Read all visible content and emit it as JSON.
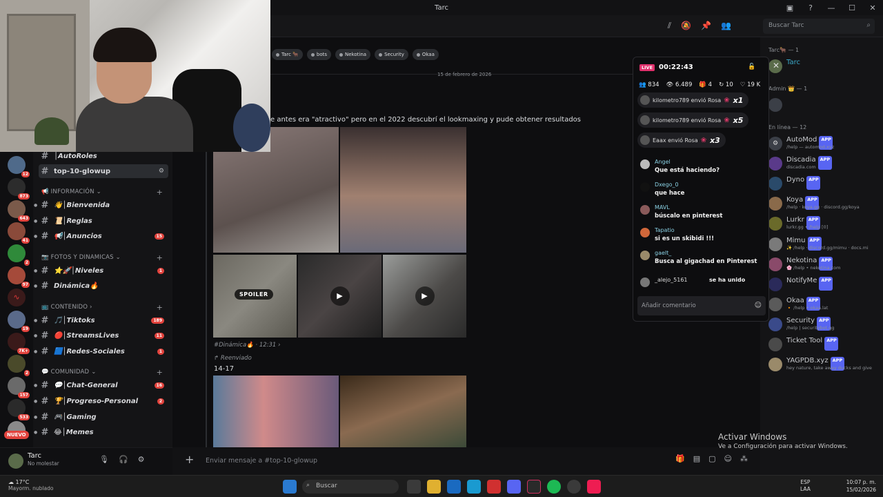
{
  "window": {
    "title": "Tarc"
  },
  "header": {
    "search_placeholder": "Buscar Tarc"
  },
  "tags": [
    "Tarc 🐂",
    "bots",
    "Nekotina",
    "Security",
    "Okaa"
  ],
  "message": {
    "date": "15 de febrero de 2026",
    "text": "e antes era \"atractivo\" pero en el 2022 descubrí el lookmaxing y pude obtener resultados",
    "spoiler_label": "SPOILER",
    "meta": "#Dinámica🔥 · 12:31 ›",
    "forwarded": "↱ Reenviado",
    "range_text": "14-17"
  },
  "servers": [
    {
      "badge": "12"
    },
    {
      "badge": "873"
    },
    {
      "badge": "643"
    },
    {
      "badge": "41"
    },
    {
      "badge": "2"
    },
    {
      "badge": "97"
    },
    {
      "badge": ""
    },
    {
      "badge": "19"
    },
    {
      "badge": "7K+"
    },
    {
      "badge": "2"
    },
    {
      "badge": "157"
    },
    {
      "badge": "533"
    },
    {
      "badge": ""
    }
  ],
  "nuevo_label": "NUEVO",
  "channels": {
    "autoroles": "│AutoRoles",
    "active": "top-10-glowup",
    "cat_info": "📢 INFORMACIÓN ⌄",
    "bienvenida": "👋│Bienvenida",
    "reglas": "📜│Reglas",
    "anuncios": "📢│Anuncios",
    "anuncios_badge": "15",
    "cat_fotos": "📷 FOTOS Y DINAMICAS ⌄",
    "niveles": "⭐🚀│Niveles",
    "niveles_badge": "1",
    "dinamica": "Dinámica🔥",
    "cat_contenido": "📺 CONTENIDO ›",
    "tiktoks": "🎵│Tiktoks",
    "tiktoks_badge": "189",
    "streams": "🔴│StreamsLives",
    "streams_badge": "11",
    "redes": "🟦│Redes-Sociales",
    "redes_badge": "1",
    "cat_comunidad": "💬 COMUNIDAD ⌄",
    "chatgeneral": "💬│Chat-General",
    "chatgeneral_badge": "16",
    "progreso": "🏆│Progreso-Personal",
    "progreso_badge": "2",
    "gaming": "🎮│Gaming",
    "memes": "😂│Memes"
  },
  "user": {
    "name": "Tarc",
    "status": "No molestar"
  },
  "composer": {
    "placeholder": "Enviar mensaje a #top-10-glowup"
  },
  "live": {
    "badge": "LIVE",
    "timer": "00:22:43",
    "stats": {
      "viewers_live": "834",
      "views": "6.489",
      "gifts": "4",
      "shares": "10",
      "likes": "19 K"
    },
    "gifts": [
      {
        "text": "kilometro789 envió Rosa",
        "mult": "x1"
      },
      {
        "text": "kilometro789 envió Rosa",
        "mult": "x5"
      },
      {
        "text": "Eaax envió Rosa",
        "mult": "x3"
      }
    ],
    "chat": [
      {
        "user": "Angel",
        "text": "Que está haciendo?"
      },
      {
        "user": "Dxego_0",
        "text": "que hace"
      },
      {
        "user": "MAVL",
        "text": "búscalo en pinterest"
      },
      {
        "user": "Tapatio",
        "text": "si es un skibidi !!!"
      },
      {
        "user": "gaelt_",
        "text": "Busca al gigachad en Pinterest"
      },
      {
        "user": "_alejo_5161",
        "text": "se ha unido"
      }
    ],
    "add_comment": "Añadir comentario"
  },
  "members": {
    "group_tarc": "Tarc🐂 — 1",
    "owner": "Tarc",
    "group_admin": "Admin 👑 — 1",
    "group_online": "En línea — 12",
    "app_label": "APP",
    "list": [
      {
        "name": "AutoMod",
        "sub": "/help — automod.xyz"
      },
      {
        "name": "Discadia",
        "sub": "discadia.com"
      },
      {
        "name": "Dyno",
        "sub": ""
      },
      {
        "name": "Koya",
        "sub": "/help · koya.gg · discord.gg/koya"
      },
      {
        "name": "Lurkr",
        "sub": "lurkr.gg • /help [0]"
      },
      {
        "name": "Mimu",
        "sub": "✨ /help · discord.gg/mimu · docs.mi"
      },
      {
        "name": "Nekotina",
        "sub": "🌸 /help • nekotina.com"
      },
      {
        "name": "NotifyMe",
        "sub": ""
      },
      {
        "name": "Okaa",
        "sub": "🔸 /help • okaa.lat"
      },
      {
        "name": "Security",
        "sub": "/help | securitybot.gg"
      },
      {
        "name": "Ticket Tool",
        "sub": ""
      },
      {
        "name": "YAGPDB.xyz",
        "sub": "hey nature, take away ducks and give"
      }
    ]
  },
  "windows_notice": {
    "line1": "Activar Windows",
    "line2": "Ve a Configuración para activar Windows."
  },
  "taskbar": {
    "temp": "17°C",
    "weather": "Mayorm. nublado",
    "search": "Buscar",
    "lang1": "ESP",
    "lang2": "LAA",
    "time": "10:07 p. m.",
    "date": "15/02/2026"
  },
  "colors": {
    "accent": "#5865f2",
    "live": "#e1306c",
    "badge": "#e2433d"
  }
}
